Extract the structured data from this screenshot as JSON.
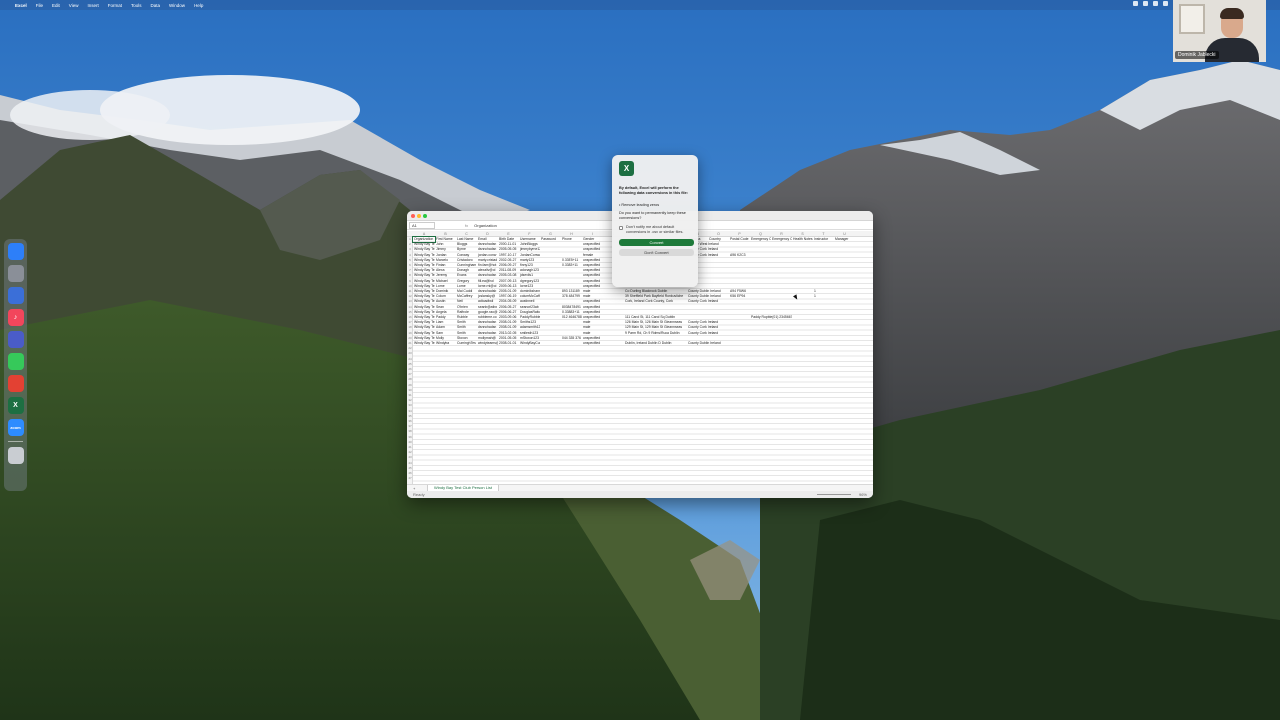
{
  "menubar": {
    "apple": "",
    "items": [
      "Excel",
      "File",
      "Edit",
      "View",
      "Insert",
      "Format",
      "Tools",
      "Data",
      "Window",
      "Help"
    ]
  },
  "webcam": {
    "name": "Dominik Jablecki"
  },
  "dock": {
    "icons": [
      {
        "name": "finder-icon",
        "color": "#2d7ff9",
        "glyph": ""
      },
      {
        "name": "launchpad-icon",
        "color": "#8a8f98",
        "glyph": ""
      },
      {
        "name": "files-icon",
        "color": "#3b6fd8",
        "glyph": ""
      },
      {
        "name": "music-icon",
        "color": "#f2465c",
        "glyph": "♪"
      },
      {
        "name": "drive-icon",
        "color": "#4a5cc8",
        "glyph": ""
      },
      {
        "name": "messages-icon",
        "color": "#36c95a",
        "glyph": ""
      },
      {
        "name": "chrome-icon",
        "color": "#e34133",
        "glyph": ""
      },
      {
        "name": "excel-icon",
        "color": "#1d6f42",
        "glyph": "X"
      },
      {
        "name": "zoom-icon",
        "color": "#2d8cff",
        "glyph": "zoom"
      },
      {
        "name": "trash-icon",
        "color": "#c9cdd2",
        "glyph": ""
      }
    ]
  },
  "excel": {
    "title": "",
    "namebox": "A1",
    "fx": "fx",
    "formula_value": "Organization",
    "columns": [
      "A",
      "B",
      "C",
      "D",
      "E",
      "F",
      "G",
      "H",
      "I",
      "J",
      "K",
      "L",
      "M",
      "N",
      "O",
      "P",
      "Q",
      "R",
      "S",
      "T",
      "U"
    ],
    "headers": [
      "Organization",
      "First Name",
      "Last Name",
      "Email",
      "Birth Date",
      "Username",
      "Password",
      "Phone",
      "Gender",
      "",
      "",
      "",
      "",
      "",
      "Address",
      "Country",
      "Postal Code",
      "Emergency C",
      "Emergency C",
      "Health Notes",
      "Instructor",
      "Manager"
    ],
    "rows": [
      [
        "Windy Bay Te",
        "John",
        "Bloggs",
        "dsnnchadsn",
        "2000-11-01",
        "JohnBloggs",
        "",
        "",
        "unspecified"
      ],
      [
        "Windy Bay Te",
        "Jimmy",
        "Byrne",
        "dsnnchadsn",
        "2005-05-05",
        "jimmybyrne123",
        "",
        "",
        "unspecified"
      ],
      [
        "Windy Bay Te",
        "Jordan",
        "Conway",
        "jordan.conw",
        "1997-10-17",
        "JordanConway",
        "",
        "",
        "female"
      ],
      [
        "Windy Bay Te",
        "Marcelo",
        "Cristadoro",
        "marty.cristad",
        "2002-05-27",
        "marty123",
        "",
        "0.33E5+11",
        "unspecified"
      ],
      [
        "Windy Bay Te",
        "Fintan",
        "Cunningham",
        "fin.fam@hot",
        "2006-09-27",
        "finny123",
        "",
        "0.3383+11",
        "unspecified"
      ],
      [
        "Windy Bay Te",
        "Alexa",
        "Donagh",
        "alexaliv@ol",
        "2011-08-09",
        "adonagh123",
        "",
        "",
        "unspecified"
      ],
      [
        "Windy Bay Te",
        "Jeremy",
        "Evans",
        "dsnnchadsn",
        "2005-03-08",
        "jdsevils1",
        "",
        "",
        "unspecified"
      ],
      [
        "Windy Bay Te",
        "Michael",
        "Gregory",
        "fill.ea@hol",
        "2007-09-13",
        "dgregory123",
        "",
        "",
        "unspecified"
      ],
      [
        "Windy Bay Te",
        "Lorne",
        "Lorne",
        "lorne.rnl@oi",
        "2009-06-13",
        "lorne123",
        "",
        "",
        "unspecified"
      ],
      [
        "Windy Bay Te",
        "Dominik",
        "Mai Cuddi",
        "dsnnchadsb",
        "2005-01-09",
        "dominikshannondc",
        "",
        "893 131189",
        "male"
      ],
      [
        "Windy Bay Te",
        "Colum",
        "McCaffrey",
        "jcslansky@",
        "1997-06-19",
        "columMcCaffrey",
        "",
        "378 484799",
        "male"
      ],
      [
        "Windy Bay Te",
        "Austin",
        "Neil",
        "adtoadtwil",
        "2004-05-09",
        "austinneil",
        "",
        "",
        "unspecified"
      ],
      [
        "Windy Bay Te",
        "Sean",
        "O'brien",
        "seanb@atbx",
        "2006-05-27",
        "seanorl23ab",
        "",
        "8038478491",
        "unspecified"
      ],
      [
        "Windy Bay Te",
        "Angela",
        "Raftrole",
        "google.rao@",
        "2006-06-27",
        "DouglasRaitcole",
        "",
        "0.33883+11",
        "unspecified"
      ],
      [
        "Windy Bay Te",
        "Paddy",
        "Rubble",
        "rubbleme.co",
        "2003-09-06",
        "PaddyRubble",
        "",
        "012 4646788",
        "unspecified"
      ],
      [
        "Windy Bay Te",
        "Liam",
        "Smith",
        "dsnnchadsn",
        "2008-01-09",
        "Smiths123",
        "",
        "",
        "male"
      ],
      [
        "Windy Bay Te",
        "Adam",
        "Smith",
        "dsnnchadsn",
        "2008-01-09",
        "adamsmith123",
        "",
        "",
        "male"
      ],
      [
        "Windy Bay Te",
        "Sam",
        "Smith",
        "dsnnchadsn",
        "2013-02-05",
        "smilesth123",
        "",
        "",
        "male"
      ],
      [
        "Windy Bay Te",
        "Molly",
        "Stoxon",
        "mollymah@",
        "2001-05-05",
        "mStoxon123",
        "",
        "044 335 376",
        "unspecified"
      ],
      [
        "Windy Bay Te",
        "Windyba",
        "CuminghTes",
        "windyteams@",
        "2008-01-01",
        "WindyBayCurningh/Tinsc",
        "",
        "",
        "unspecified"
      ]
    ],
    "extra": [
      {
        "row": 9,
        "addr": "Co Durling Blackrock Dublin",
        "county": "County Dublin Ireland",
        "postal": "A94 F5W6",
        "em": "",
        "flag": "1"
      },
      {
        "row": 10,
        "addr": "39 Sheffield Park Bayfield Ronkuvliche",
        "county": "County Dublin Ireland",
        "postal": "K56 EP94",
        "em": "",
        "flag": "1"
      },
      {
        "row": 11,
        "addr": "Cork, Ireland Cork County, Cork",
        "county": "County Cork Ireland",
        "postal": "",
        "em": "",
        "flag": ""
      },
      {
        "row": 14,
        "addr": "111 Carol St, 111 Carol Sq Dublin",
        "county": "",
        "postal": "",
        "em": "Paddy Rupble(01) 23456678",
        "flag": ""
      },
      {
        "row": 15,
        "addr": "126 Main St, 126 Main St Gleannseas",
        "county": "County Cork Ireland",
        "postal": "",
        "em": "",
        "flag": ""
      },
      {
        "row": 16,
        "addr": "129 Main St, 129 Main St Gleannseas",
        "county": "County Cork Ireland",
        "postal": "",
        "em": "",
        "flag": ""
      },
      {
        "row": 17,
        "addr": "9 Parm Rd, Ch 9 Rdms/Ruca Dublin",
        "county": "County Cork Ireland",
        "postal": "",
        "em": "",
        "flag": ""
      },
      {
        "row": 19,
        "addr": "Dublin, Ireland Dublin D Dublin",
        "county": "County Dublin Ireland",
        "postal": "",
        "em": "",
        "flag": ""
      }
    ],
    "top_right_extra": [
      {
        "row": 0,
        "text": "County West Ireland"
      },
      {
        "row": 1,
        "text": "County Cork Ireland"
      },
      {
        "row": 2,
        "text": "County Cork Ireland",
        "postal": "A96 K2C3"
      }
    ],
    "sheet_tab": "Windy Bay Test Club Person List",
    "add_sheet": "+",
    "status": "Ready",
    "zoom": "96%"
  },
  "dialog": {
    "message": "By default, Excel will perform the following data conversions in this file:",
    "item": "• Remove leading zeros",
    "question": "Do you want to permanently keep these conversions?",
    "checkbox_label": "Don't notify me about default conversions in .csv or similar files.",
    "convert": "Convert",
    "dont_convert": "Don't Convert"
  }
}
